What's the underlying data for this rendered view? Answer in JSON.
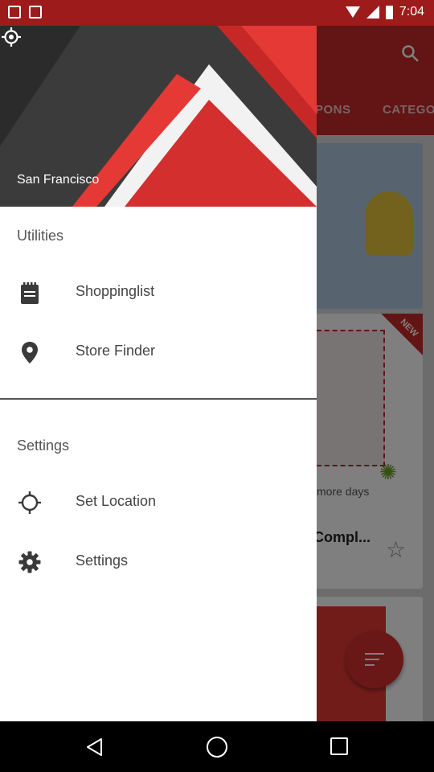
{
  "status_bar": {
    "time": "7:04"
  },
  "background_app": {
    "tabs": [
      "PONS",
      "CATEGO"
    ],
    "coupon_days_text": "more days",
    "coupon_title_text": "Compl...",
    "new_badge": "NEW"
  },
  "drawer": {
    "header": {
      "city": "San Francisco"
    },
    "sections": {
      "utilities": {
        "title": "Utilities",
        "items": [
          {
            "label": "Shoppinglist",
            "icon": "shopping-list-icon"
          },
          {
            "label": "Store Finder",
            "icon": "map-pin-icon"
          }
        ]
      },
      "settings": {
        "title": "Settings",
        "items": [
          {
            "label": "Set Location",
            "icon": "crosshair-icon"
          },
          {
            "label": "Settings",
            "icon": "gear-icon"
          }
        ]
      }
    }
  },
  "colors": {
    "brand_red": "#c62828",
    "status_bar": "#9e1b1b",
    "drawer_bg": "#ffffff",
    "icon_dark": "#3a3a3a"
  }
}
